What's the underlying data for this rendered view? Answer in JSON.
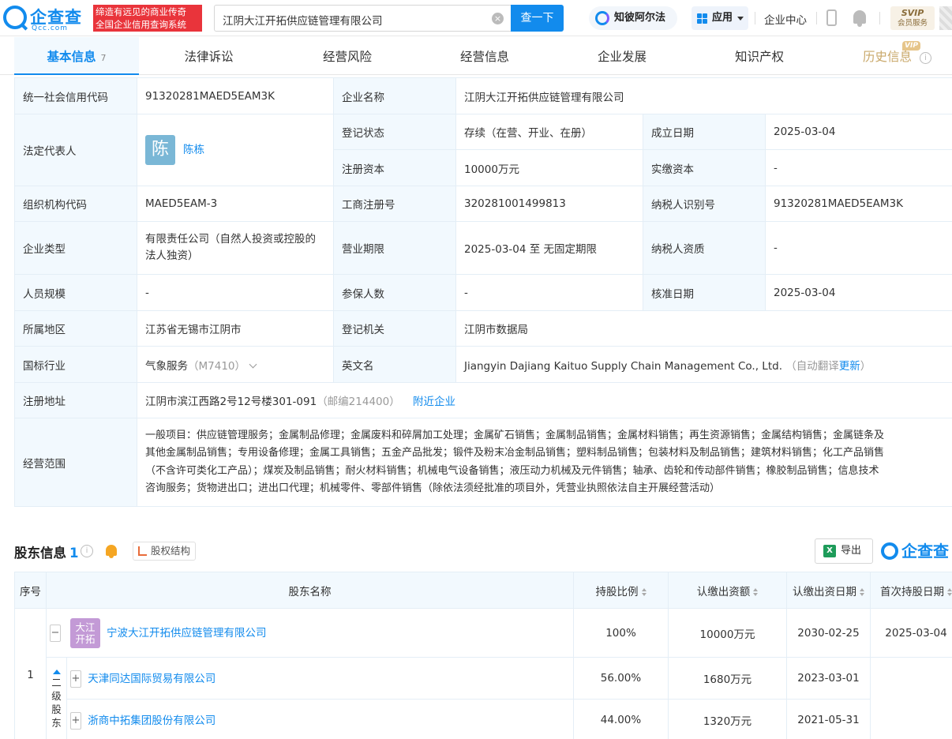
{
  "header": {
    "brand": "企查查",
    "brand_sub": "Qcc.com",
    "slogan_line1": "缔造有远见的商业传奇",
    "slogan_line2": "全国企业信用查询系统",
    "search_value": "江阴大江开拓供应链管理有限公司",
    "search_button": "查一下",
    "zhibi": "知彼阿尔法",
    "apps": "应用",
    "enterprise_center": "企业中心",
    "svip_line1": "SVIP",
    "svip_line2": "会员服务"
  },
  "tabs": [
    {
      "label": "基本信息",
      "count": "7"
    },
    {
      "label": "法律诉讼"
    },
    {
      "label": "经营风险"
    },
    {
      "label": "经营信息"
    },
    {
      "label": "企业发展"
    },
    {
      "label": "知识产权"
    },
    {
      "label": "历史信息"
    }
  ],
  "vip_badge": "VIP",
  "info": {
    "credit_code_label": "统一社会信用代码",
    "credit_code": "91320281MAED5EAM3K",
    "company_name_label": "企业名称",
    "company_name": "江阴大江开拓供应链管理有限公司",
    "legal_rep_label": "法定代表人",
    "legal_rep_avatar": "陈",
    "legal_rep": "陈栋",
    "reg_status_label": "登记状态",
    "reg_status": "存续（在营、开业、在册）",
    "found_date_label": "成立日期",
    "found_date": "2025-03-04",
    "reg_capital_label": "注册资本",
    "reg_capital": "10000万元",
    "paid_capital_label": "实缴资本",
    "paid_capital": "-",
    "org_code_label": "组织机构代码",
    "org_code": "MAED5EAM-3",
    "biz_reg_no_label": "工商注册号",
    "biz_reg_no": "320281001499813",
    "taxpayer_id_label": "纳税人识别号",
    "taxpayer_id": "91320281MAED5EAM3K",
    "company_type_label": "企业类型",
    "company_type_1": "有限责任公司（自然人投资或控股的",
    "company_type_2": "法人独资）",
    "biz_term_label": "营业期限",
    "biz_term": "2025-03-04 至 无固定期限",
    "taxpayer_qual_label": "纳税人资质",
    "taxpayer_qual": "-",
    "staff_size_label": "人员规模",
    "staff_size": "-",
    "insured_label": "参保人数",
    "insured": "-",
    "approval_date_label": "核准日期",
    "approval_date": "2025-03-04",
    "region_label": "所属地区",
    "region": "江苏省无锡市江阴市",
    "reg_authority_label": "登记机关",
    "reg_authority": "江阴市数据局",
    "industry_label": "国标行业",
    "industry": "气象服务",
    "industry_code": "（M7410）",
    "english_name_label": "英文名",
    "english_name": "Jiangyin Dajiang Kaituo Supply Chain Management Co., Ltd.",
    "auto_translate": "（自动翻译",
    "update": "更新",
    "close_paren": "）",
    "address_label": "注册地址",
    "address": "江阴市滨江西路2号12号楼301-091",
    "postcode": "（邮编214400）",
    "nearby": "附近企业",
    "scope_label": "经营范围",
    "scope_1": "一般项目：供应链管理服务；金属制品修理；金属废料和碎屑加工处理；金属矿石销售；金属制品销售；金属材料销售；再生资源销售；金属结构销售；金属链条及",
    "scope_2": "其他金属制品销售；专用设备修理；金属工具销售；五金产品批发；锻件及粉末冶金制品销售；塑料制品销售；包装材料及制品销售；建筑材料销售；化工产品销售",
    "scope_3": "（不含许可类化工产品）；煤炭及制品销售；耐火材料销售；机械电气设备销售；液压动力机械及元件销售；轴承、齿轮和传动部件销售；橡胶制品销售；信息技术",
    "scope_4": "咨询服务；货物进出口；进出口代理；机械零件、零部件销售（除依法须经批准的项目外，凭营业执照依法自主开展经营活动）"
  },
  "shareholders": {
    "title": "股东信息",
    "count": "1",
    "equity_structure": "股权结构",
    "export": "导出",
    "export_icon_text": "X",
    "watermark": "企查查",
    "columns": [
      "序号",
      "股东名称",
      "持股比例",
      "认缴出资额",
      "认缴出资日期",
      "首次持股日期"
    ],
    "row_no": "1",
    "level_label": [
      "二",
      "级",
      "股",
      "东"
    ],
    "main": {
      "logo_1": "大江",
      "logo_2": "开拓",
      "name": "宁波大江开拓供应链管理有限公司",
      "ratio": "100%",
      "amount": "10000万元",
      "sub_date": "2030-02-25",
      "first_date": "2025-03-04"
    },
    "sub": [
      {
        "name": "天津同达国际贸易有限公司",
        "ratio": "56.00%",
        "amount": "1680万元",
        "sub_date": "2023-03-01"
      },
      {
        "name": "浙商中拓集团股份有限公司",
        "ratio": "44.00%",
        "amount": "1320万元",
        "sub_date": "2021-05-31"
      }
    ]
  }
}
